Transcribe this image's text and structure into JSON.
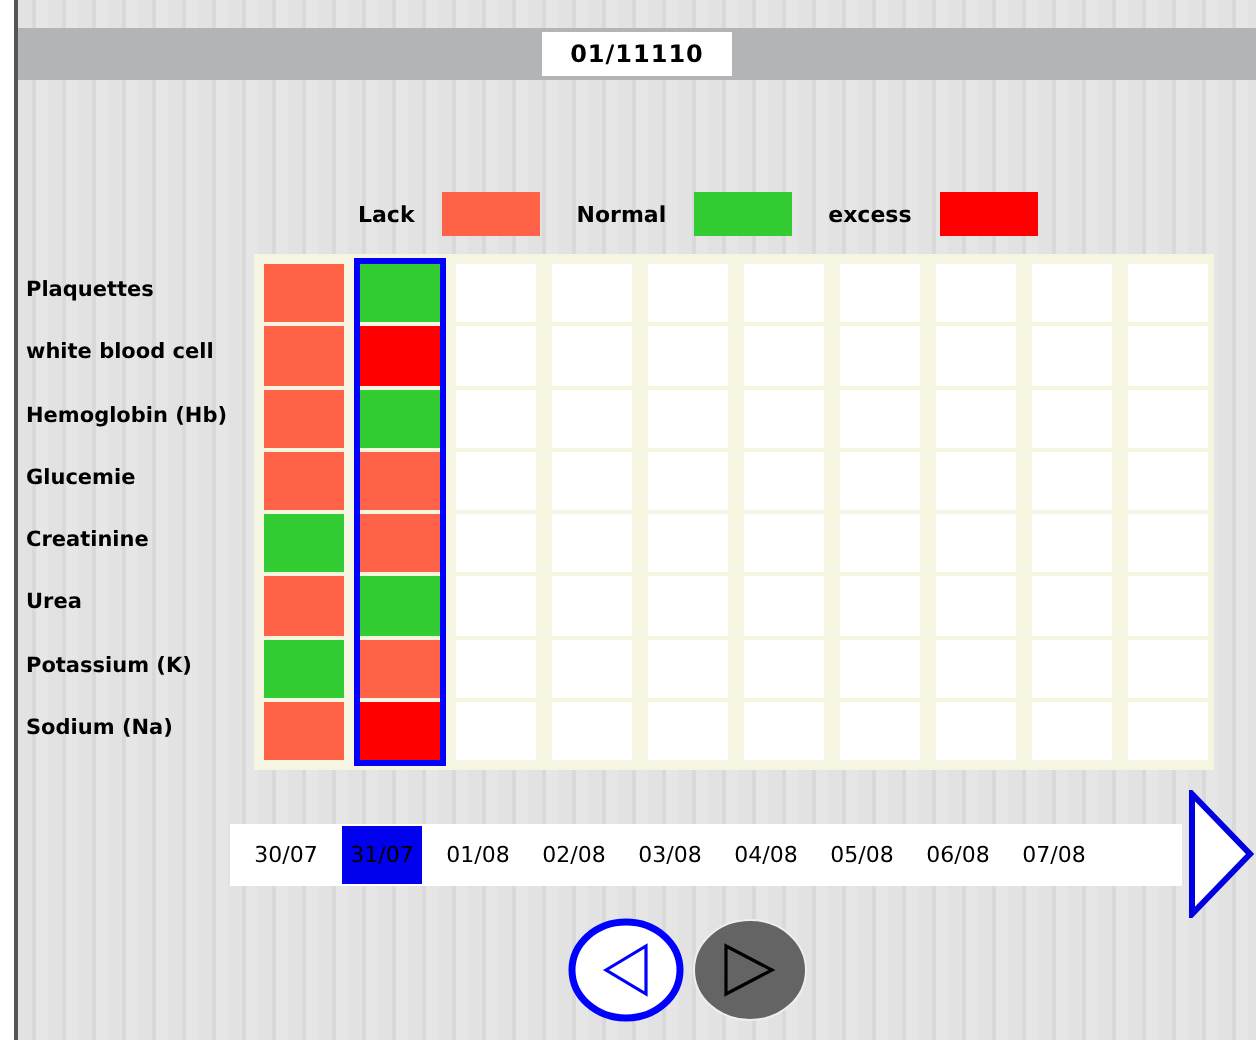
{
  "record_number": "01/11110",
  "legend": [
    {
      "label": "Lack",
      "kind": "lack",
      "color": "#ff6347"
    },
    {
      "label": "Normal",
      "kind": "normal",
      "color": "#33cc33"
    },
    {
      "label": "excess",
      "kind": "excess",
      "color": "#ff0000"
    }
  ],
  "tests": [
    {
      "name": "Plaquettes",
      "results": [
        {
          "kind": "lack"
        },
        {
          "kind": "normal"
        }
      ]
    },
    {
      "name": "white blood cell",
      "results": [
        {
          "kind": "lack"
        },
        {
          "kind": "excess"
        }
      ]
    },
    {
      "name": "Hemoglobin (Hb)",
      "results": [
        {
          "kind": "lack"
        },
        {
          "kind": "normal"
        }
      ]
    },
    {
      "name": "Glucemie",
      "results": [
        {
          "kind": "lack"
        },
        {
          "kind": "lack"
        }
      ]
    },
    {
      "name": "Creatinine",
      "results": [
        {
          "kind": "normal"
        },
        {
          "kind": "lack"
        }
      ]
    },
    {
      "name": "Urea",
      "results": [
        {
          "kind": "lack"
        },
        {
          "kind": "normal"
        }
      ]
    },
    {
      "name": "Potassium (K)",
      "results": [
        {
          "kind": "normal"
        },
        {
          "kind": "lack"
        }
      ]
    },
    {
      "name": "Sodium (Na)",
      "results": [
        {
          "kind": "lack"
        },
        {
          "kind": "excess"
        }
      ]
    }
  ],
  "dates": [
    {
      "label": "30/07",
      "selected": false
    },
    {
      "label": "31/07",
      "selected": true
    },
    {
      "label": "01/08",
      "selected": false
    },
    {
      "label": "02/08",
      "selected": false
    },
    {
      "label": "03/08",
      "selected": false
    },
    {
      "label": "04/08",
      "selected": false
    },
    {
      "label": "05/08",
      "selected": false
    },
    {
      "label": "06/08",
      "selected": false
    },
    {
      "label": "07/08",
      "selected": false
    }
  ]
}
